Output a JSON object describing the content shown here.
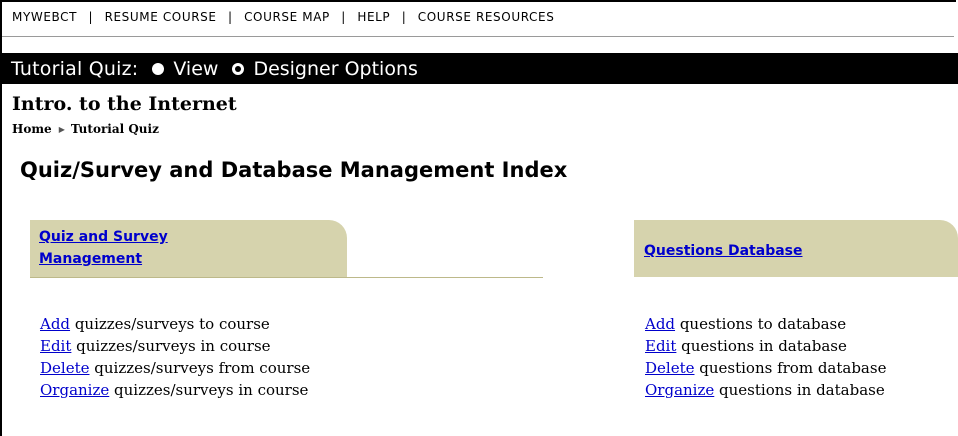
{
  "topnav": {
    "items": [
      "MYWEBCT",
      "RESUME COURSE",
      "COURSE MAP",
      "HELP",
      "COURSE RESOURCES"
    ],
    "separator": "|"
  },
  "toolbar": {
    "tool_label": "Tutorial Quiz:",
    "view_label": "View",
    "designer_label": "Designer Options",
    "selected": "designer"
  },
  "course": {
    "title": "Intro. to the Internet"
  },
  "breadcrumb": {
    "home": "Home",
    "current": "Tutorial Quiz",
    "arrow": "▶"
  },
  "page": {
    "title": "Quiz/Survey and Database Management Index"
  },
  "quiz_section": {
    "heading_line1": "Quiz and Survey",
    "heading_line2": "Management",
    "items": [
      {
        "link": "Add",
        "text": " quizzes/surveys to course"
      },
      {
        "link": "Edit",
        "text": " quizzes/surveys in course"
      },
      {
        "link": "Delete",
        "text": " quizzes/surveys from course"
      },
      {
        "link": "Organize",
        "text": " quizzes/surveys in course"
      }
    ]
  },
  "db_section": {
    "heading": "Questions Database",
    "items": [
      {
        "link": "Add",
        "text": " questions to database"
      },
      {
        "link": "Edit",
        "text": " questions in database"
      },
      {
        "link": "Delete",
        "text": " questions from database"
      },
      {
        "link": "Organize",
        "text": " questions in database"
      }
    ]
  },
  "colors": {
    "tab_background": "#d6d3ad",
    "link": "#0000cc",
    "toolbar_background": "#000000"
  }
}
